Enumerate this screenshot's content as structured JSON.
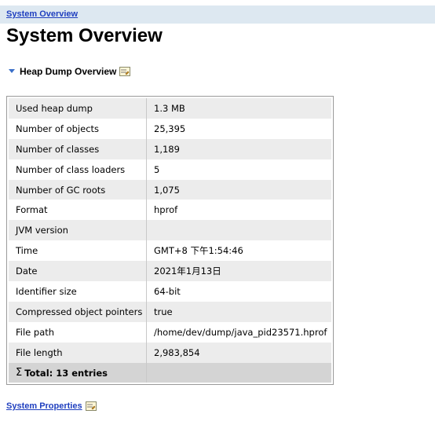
{
  "breadcrumb": {
    "label": "System Overview"
  },
  "page": {
    "title": "System Overview"
  },
  "section": {
    "title": "Heap Dump Overview"
  },
  "table": {
    "rows": [
      {
        "key": "Used heap dump",
        "value": "1.3 MB"
      },
      {
        "key": "Number of objects",
        "value": "25,395"
      },
      {
        "key": "Number of classes",
        "value": "1,189"
      },
      {
        "key": "Number of class loaders",
        "value": "5"
      },
      {
        "key": "Number of GC roots",
        "value": "1,075"
      },
      {
        "key": "Format",
        "value": "hprof"
      },
      {
        "key": "JVM version",
        "value": ""
      },
      {
        "key": "Time",
        "value": "GMT+8 下午1:54:46"
      },
      {
        "key": "Date",
        "value": "2021年1月13日"
      },
      {
        "key": "Identifier size",
        "value": "64-bit"
      },
      {
        "key": "Compressed object pointers",
        "value": "true"
      },
      {
        "key": "File path",
        "value": "/home/dev/dump/java_pid23571.hprof"
      },
      {
        "key": "File length",
        "value": "2,983,854"
      }
    ],
    "total": {
      "symbol": "Σ",
      "label": "Total: 13 entries"
    }
  },
  "footer": {
    "link_label": "System Properties"
  },
  "icons": {
    "collapse": "triangle-down-icon",
    "details": "details-icon"
  },
  "colors": {
    "link": "#1f3fbf",
    "breadcrumb_bg": "#dde8f1",
    "row_alt": "#ececec",
    "total_row": "#d4d4d4",
    "toggle": "#3a6fc8"
  }
}
